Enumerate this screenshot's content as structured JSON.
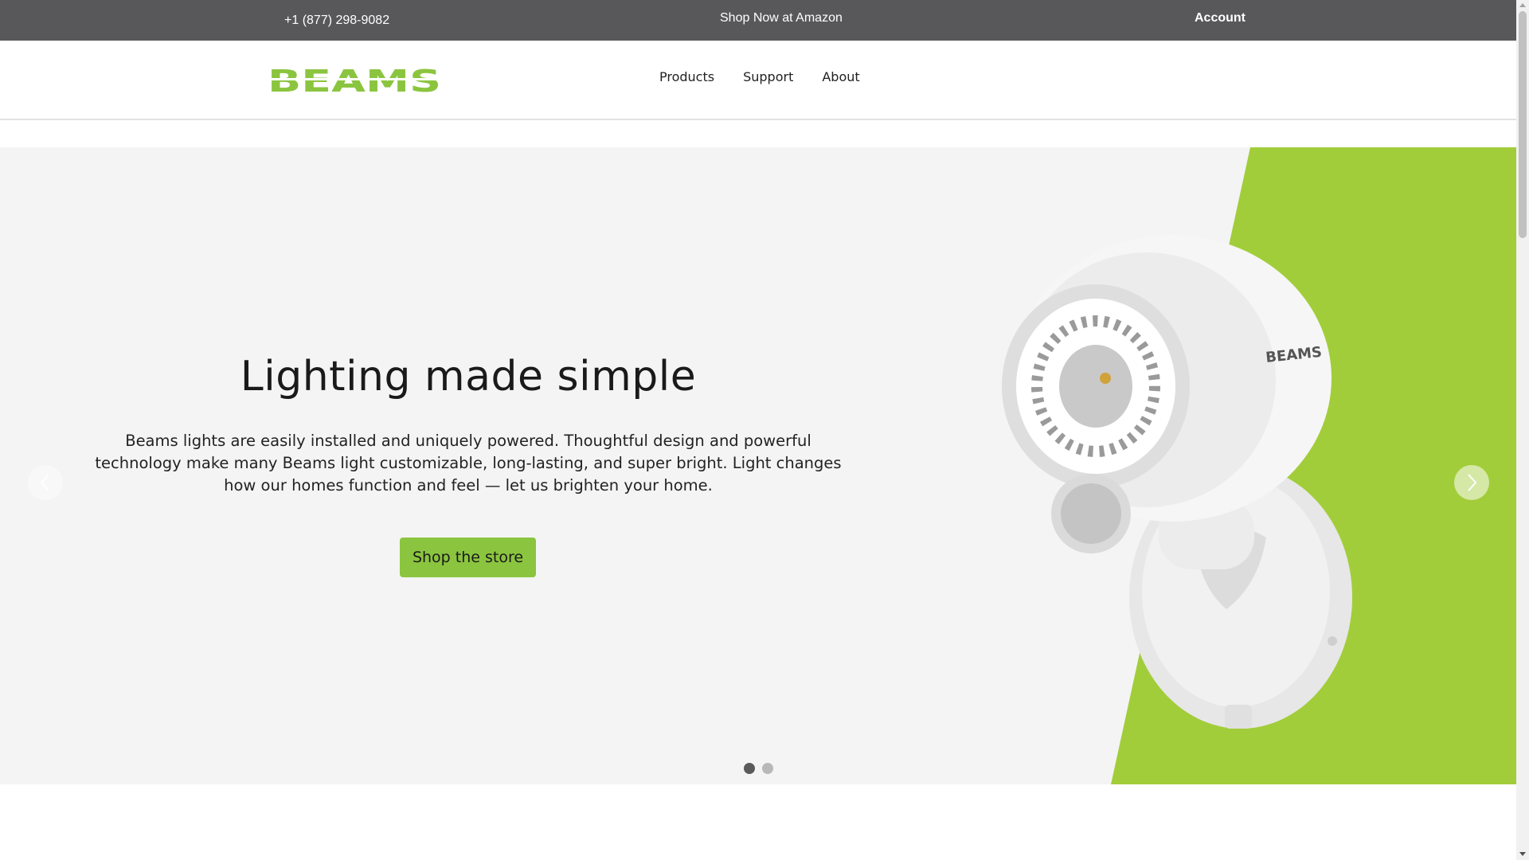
{
  "topbar": {
    "phone": "+1 (877) 298-9082",
    "amazon_link": "Shop Now at Amazon",
    "account_link": "Account"
  },
  "header": {
    "logo_text": "BEAMS",
    "nav": [
      "Products",
      "Support",
      "About"
    ]
  },
  "hero": {
    "title": "Lighting made simple",
    "lead": "Beams lights are easily installed and uniquely powered. Thoughtful design and powerful technology make many Beams light customizable, long-lasting, and super bright. Light changes how our homes function and feel — let us brighten your home.",
    "cta_label": "Shop the store",
    "product_brand": "BEAMS",
    "slides_total": 2,
    "active_slide": 1
  },
  "colors": {
    "topbar_bg": "#58585a",
    "brand_green": "#8bc53f",
    "hero_green": "#a2cd3a",
    "hero_bg": "#f4f4f4"
  },
  "icons": {
    "prev": "chevron-left-icon",
    "next": "chevron-right-icon"
  }
}
